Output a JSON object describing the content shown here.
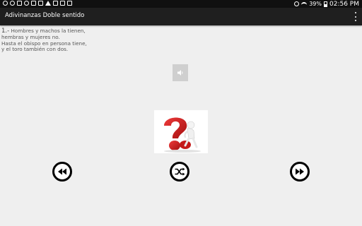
{
  "status_bar": {
    "battery_percent": "39%",
    "time": "02:56 PM"
  },
  "app_bar": {
    "title": "Adivinanzas Doble sentido"
  },
  "riddle": {
    "number": "1.-",
    "lines": [
      "Hombres y machos la tienen,",
      "hembras y mujeres no.",
      "Hasta el obispo en persona tiene,",
      "y el toro también con dos."
    ]
  },
  "icons": {
    "sound": "speaker-icon",
    "picture": "question-mark-figure",
    "previous": "rewind-icon",
    "random": "shuffle-icon",
    "next": "fast-forward-icon"
  },
  "colors": {
    "status_bar": "#101010",
    "app_bar": "#1f1f1f",
    "background": "#efefef",
    "question_red": "#d51f1f"
  }
}
